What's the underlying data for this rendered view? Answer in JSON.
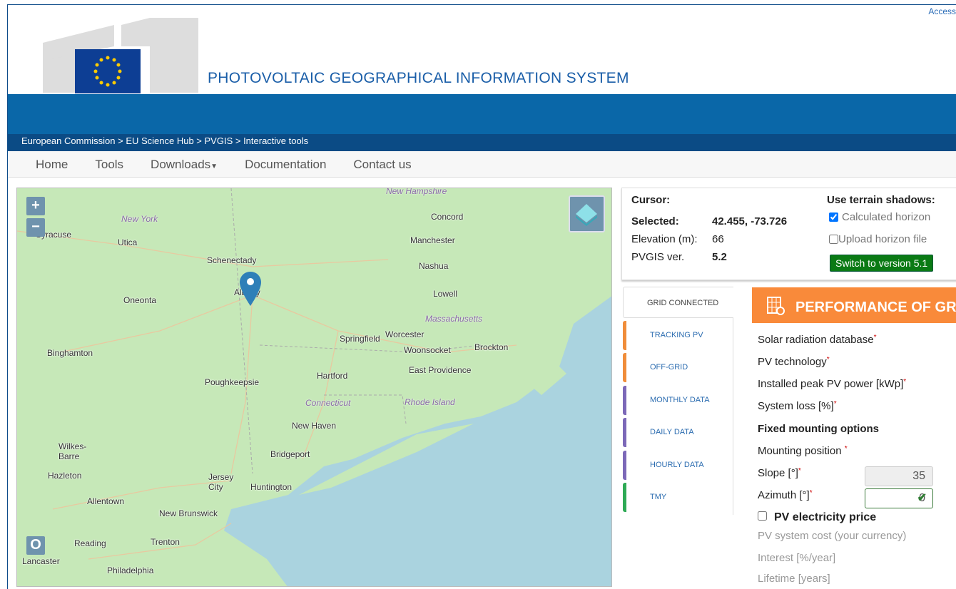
{
  "header": {
    "access": "Access",
    "title": "PHOTOVOLTAIC GEOGRAPHICAL INFORMATION SYSTEM",
    "logo_text": "European Commission"
  },
  "breadcrumb": "European Commission > EU Science Hub > PVGIS > Interactive tools",
  "nav": [
    "Home",
    "Tools",
    "Downloads",
    "Documentation",
    "Contact us"
  ],
  "map": {
    "zoom_in": "+",
    "zoom_out": "−",
    "ctrl_o": "O",
    "cities": [
      "Syracuse",
      "Utica",
      "Schenectady",
      "Albany",
      "Oneonta",
      "Binghamton",
      "Poughkeepsie",
      "Concord",
      "Manchester",
      "Nashua",
      "Lowell",
      "Worcester",
      "Springfield",
      "Woonsocket",
      "Brockton",
      "East Providence",
      "Hartford",
      "New Haven",
      "Bridgeport",
      "Wilkes-Barre",
      "Hazleton",
      "Jersey City",
      "Huntington",
      "Allentown",
      "New Brunswick",
      "Reading",
      "Trenton",
      "Lancaster",
      "Philadelphia"
    ],
    "states": [
      "New Hampshire",
      "New York",
      "Massachusetts",
      "Connecticut",
      "Rhode Island"
    ]
  },
  "info": {
    "cursor": "Cursor:",
    "selected_label": "Selected:",
    "selected": "42.455, -73.726",
    "elev_label": "Elevation (m):",
    "elev": "66",
    "ver_label": "PVGIS ver.",
    "ver": "5.2",
    "shadows": "Use terrain shadows:",
    "calc": "Calculated horizon",
    "upload": "Upload horizon file",
    "switch": "Switch to version 5.1"
  },
  "tabs": [
    "GRID CONNECTED",
    "TRACKING PV",
    "OFF-GRID",
    "MONTHLY DATA",
    "DAILY DATA",
    "HOURLY DATA",
    "TMY"
  ],
  "panel": {
    "title": "PERFORMANCE OF GR",
    "db": "Solar radiation database",
    "tech": "PV technology",
    "power": "Installed peak PV power [kWp]",
    "loss": "System loss [%]",
    "fixed": "Fixed mounting options",
    "mount": "Mounting position",
    "slope": "Slope [°]",
    "slope_val": "35",
    "azimuth": "Azimuth [°]",
    "azimuth_val": "0",
    "price": "PV electricity price",
    "cost": "PV system cost (your currency)",
    "interest": "Interest [%/year]",
    "lifetime": "Lifetime [years]",
    "req": "*"
  }
}
